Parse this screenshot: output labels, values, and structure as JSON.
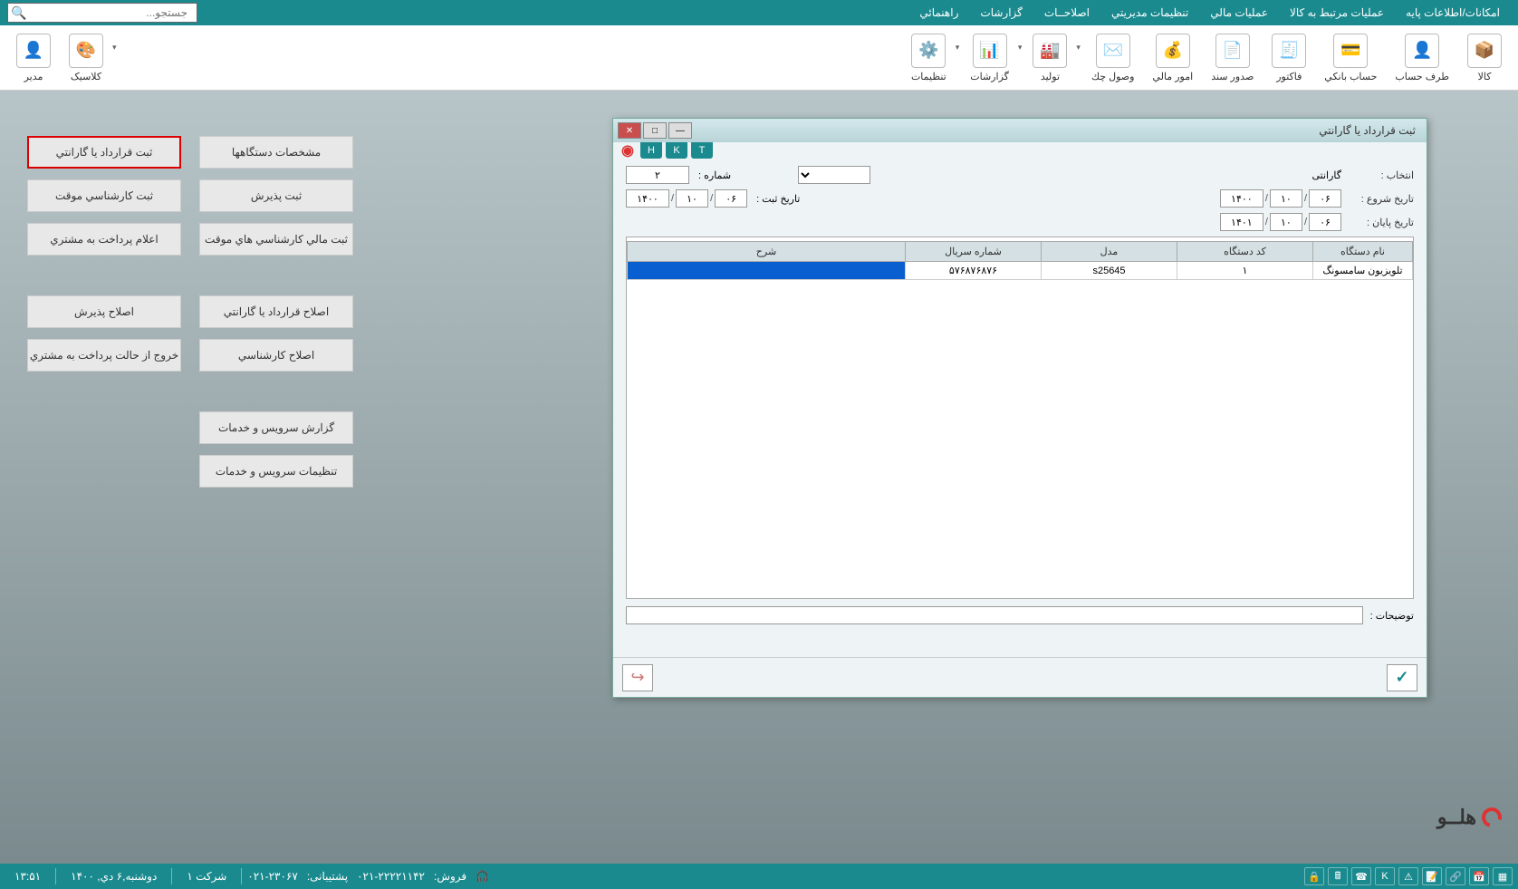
{
  "top_menu": {
    "items": [
      "امکانات/اطلاعات پایه",
      "عملیات مرتبط به کالا",
      "عملیات مالي",
      "تنظیمات مدیریتي",
      "اصلاحــات",
      "گزارشات",
      "راهنمائي"
    ]
  },
  "search": {
    "placeholder": "جستجو..."
  },
  "toolbar": {
    "items": [
      {
        "label": "کالا"
      },
      {
        "label": "طرف حساب"
      },
      {
        "label": "حساب بانکي"
      },
      {
        "label": "فاکتور"
      },
      {
        "label": "صدور سند"
      },
      {
        "label": "امور مالي"
      },
      {
        "label": "وصول چك"
      },
      {
        "label": "تولید"
      },
      {
        "label": "گزارشات"
      },
      {
        "label": "تنظیمات"
      }
    ],
    "right": [
      {
        "label": "کلاسیک"
      },
      {
        "label": "مدیر"
      }
    ]
  },
  "panel": {
    "col1": [
      "مشخصات دستگاهها",
      "ثبت پذیرش",
      "ثبت مالي کارشناسي هاي موقت",
      "اصلاح قرارداد یا گارانتي",
      "اصلاح کارشناسي",
      "گزارش سرویس و خدمات",
      "تنظیمات سرویس و خدمات"
    ],
    "col2": [
      "ثبت قرارداد یا گارانتي",
      "ثبت کارشناسي موقت",
      "اعلام پرداخت به مشتري",
      "اصلاح پذیرش",
      "خروج از حالت پرداخت به مشتري"
    ]
  },
  "dialog": {
    "title": "ثبت قرارداد یا گارانتي",
    "tabs": [
      "H",
      "K",
      "T"
    ],
    "labels": {
      "selection": "انتخاب :",
      "selection_value": "گارانتی",
      "number": "شماره :",
      "number_value": "۲",
      "start_date": "تاریخ شروع :",
      "reg_date": "تاریخ ثبت :",
      "end_date": "تاریخ پایان :",
      "description": "توضیحات :"
    },
    "dates": {
      "start": {
        "d": "۰۶",
        "m": "۱۰",
        "y": "۱۴۰۰"
      },
      "reg": {
        "d": "۰۶",
        "m": "۱۰",
        "y": "۱۴۰۰"
      },
      "end": {
        "d": "۰۶",
        "m": "۱۰",
        "y": "۱۴۰۱"
      }
    },
    "table": {
      "headers": [
        "نام دستگاه",
        "کد دستگاه",
        "مدل",
        "شماره سریال",
        "شرح"
      ],
      "row": {
        "device_name": "تلویزیون سامسونگ",
        "device_code": "۱",
        "model": "s25645",
        "serial": "۵۷۶۸۷۶۸۷۶",
        "desc": ""
      }
    }
  },
  "brand": "هلــو",
  "status": {
    "time": "۱۳:۵۱",
    "date": "دوشنبه,۶ دي, ۱۴۰۰",
    "company": "شرکت ۱",
    "support": "۰۲۱-۲۳۰۶۷",
    "support_label": "پشتیبانی:",
    "sales": "۰۲۱-۲۲۲۲۱۱۴۲",
    "sales_label": "فروش:"
  }
}
